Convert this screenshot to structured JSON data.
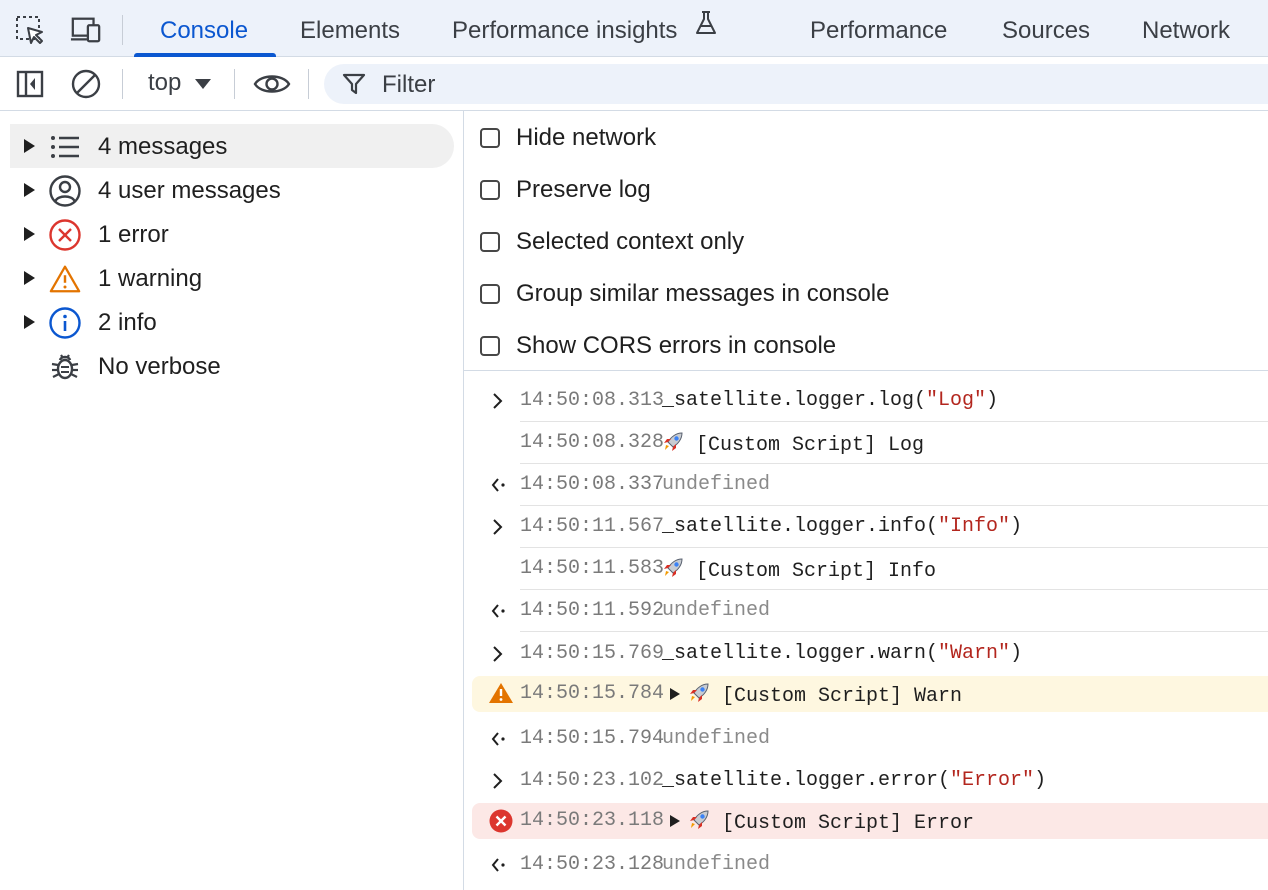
{
  "tabs": {
    "items": [
      "Console",
      "Elements",
      "Performance insights",
      "Performance",
      "Sources",
      "Network"
    ],
    "active": "Console"
  },
  "toolbar": {
    "context": "top",
    "filter_placeholder": "Filter"
  },
  "sidebar": {
    "items": [
      {
        "label": "4 messages",
        "icon": "list-icon"
      },
      {
        "label": "4 user messages",
        "icon": "user-icon"
      },
      {
        "label": "1 error",
        "icon": "error-icon"
      },
      {
        "label": "1 warning",
        "icon": "warning-icon"
      },
      {
        "label": "2 info",
        "icon": "info-icon"
      },
      {
        "label": "No verbose",
        "icon": "bug-icon"
      }
    ]
  },
  "settings": {
    "hide_network": "Hide network",
    "preserve_log": "Preserve log",
    "selected_context_only": "Selected context only",
    "group_similar": "Group similar messages in console",
    "show_cors": "Show CORS errors in console"
  },
  "console": {
    "rows": [
      {
        "kind": "input",
        "time": "14:50:08.313",
        "pre": "_satellite.logger.log(",
        "str": "\"Log\"",
        "post": ")"
      },
      {
        "kind": "output",
        "time": "14:50:08.328",
        "text": "[Custom Script] Log"
      },
      {
        "kind": "result",
        "time": "14:50:08.337",
        "text": "undefined"
      },
      {
        "kind": "input",
        "time": "14:50:11.567",
        "pre": "_satellite.logger.info(",
        "str": "\"Info\"",
        "post": ")"
      },
      {
        "kind": "output",
        "time": "14:50:11.583",
        "text": "[Custom Script] Info"
      },
      {
        "kind": "result",
        "time": "14:50:11.592",
        "text": "undefined"
      },
      {
        "kind": "input",
        "time": "14:50:15.769",
        "pre": "_satellite.logger.warn(",
        "str": "\"Warn\"",
        "post": ")"
      },
      {
        "kind": "warning",
        "time": "14:50:15.784",
        "text": "[Custom Script] Warn"
      },
      {
        "kind": "result",
        "time": "14:50:15.794",
        "text": "undefined"
      },
      {
        "kind": "input",
        "time": "14:50:23.102",
        "pre": "_satellite.logger.error(",
        "str": "\"Error\"",
        "post": ")"
      },
      {
        "kind": "error",
        "time": "14:50:23.118",
        "text": "[Custom Script] Error"
      },
      {
        "kind": "result",
        "time": "14:50:23.128",
        "text": "undefined"
      }
    ]
  },
  "colors": {
    "accent": "#0b57d0",
    "warning_bg": "#fef7e0",
    "error_bg": "#fce8e6",
    "string": "#b3261e"
  }
}
